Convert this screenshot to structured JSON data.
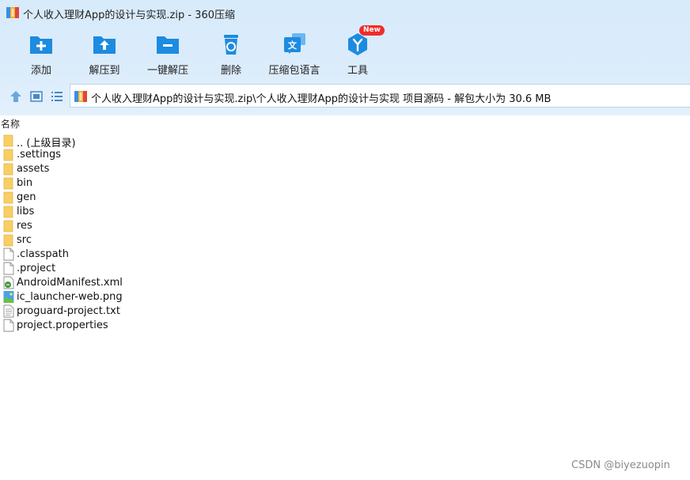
{
  "window": {
    "title": "个人收入理财App的设计与实现.zip - 360压缩"
  },
  "toolbar": {
    "items": [
      {
        "label": "添加",
        "icon": "add-icon"
      },
      {
        "label": "解压到",
        "icon": "extract-to-icon"
      },
      {
        "label": "一键解压",
        "icon": "one-click-extract-icon"
      },
      {
        "label": "删除",
        "icon": "delete-icon"
      },
      {
        "label": "压缩包语言",
        "icon": "archive-language-icon"
      },
      {
        "label": "工具",
        "icon": "tools-icon",
        "badge": "New"
      }
    ]
  },
  "nav": {
    "address": "个人收入理财App的设计与实现.zip\\个人收入理财App的设计与实现 项目源码 - 解包大小为 30.6 MB"
  },
  "list": {
    "column_name": "名称",
    "items": [
      {
        "name": ".. (上级目录)",
        "type": "folder"
      },
      {
        "name": ".settings",
        "type": "folder"
      },
      {
        "name": "assets",
        "type": "folder"
      },
      {
        "name": "bin",
        "type": "folder"
      },
      {
        "name": "gen",
        "type": "folder"
      },
      {
        "name": "libs",
        "type": "folder"
      },
      {
        "name": "res",
        "type": "folder"
      },
      {
        "name": "src",
        "type": "folder"
      },
      {
        "name": ".classpath",
        "type": "file"
      },
      {
        "name": ".project",
        "type": "file"
      },
      {
        "name": "AndroidManifest.xml",
        "type": "xml"
      },
      {
        "name": "ic_launcher-web.png",
        "type": "image"
      },
      {
        "name": "proguard-project.txt",
        "type": "text"
      },
      {
        "name": "project.properties",
        "type": "file"
      }
    ]
  },
  "watermark": "CSDN @biyezuopin",
  "colors": {
    "accent": "#1d8be0",
    "folder": "#f7cf63",
    "badge": "#f02c2c"
  }
}
